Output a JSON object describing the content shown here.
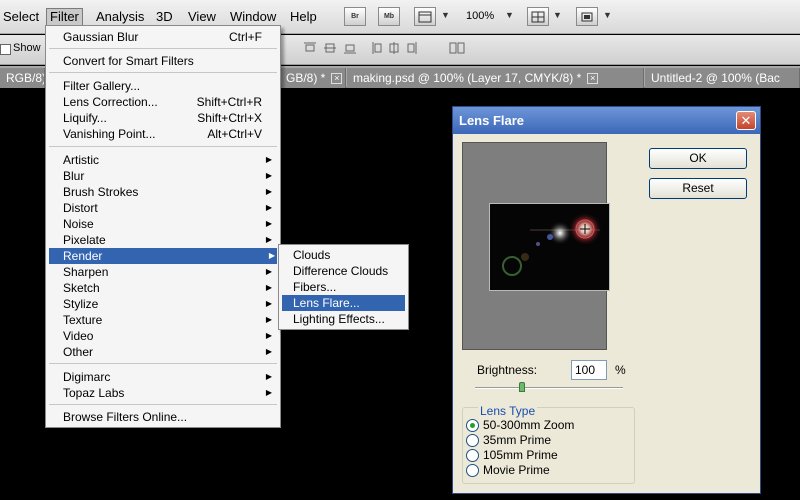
{
  "menubar": {
    "items": [
      "Select",
      "Filter",
      "Analysis",
      "3D",
      "View",
      "Window",
      "Help"
    ],
    "active": "Filter"
  },
  "toolbar": {
    "br_label": "Br",
    "mb_label": "Mb",
    "zoom": "100%",
    "dropdown_glyph": "▼"
  },
  "options": {
    "show_label": "Show"
  },
  "tabs": [
    {
      "label": "RGB/8)"
    },
    {
      "label": "GB/8) *"
    },
    {
      "label": "making.psd @ 100% (Layer 17, CMYK/8) *"
    },
    {
      "label": "Untitled-2 @ 100% (Bac"
    }
  ],
  "filter_menu": {
    "gaussian_blur": {
      "label": "Gaussian Blur",
      "shortcut": "Ctrl+F"
    },
    "convert_smart": "Convert for Smart Filters",
    "filter_gallery": "Filter Gallery...",
    "lens_correction": {
      "label": "Lens Correction...",
      "shortcut": "Shift+Ctrl+R"
    },
    "liquify": {
      "label": "Liquify...",
      "shortcut": "Shift+Ctrl+X"
    },
    "vanishing_point": {
      "label": "Vanishing Point...",
      "shortcut": "Alt+Ctrl+V"
    },
    "submenus": [
      "Artistic",
      "Blur",
      "Brush Strokes",
      "Distort",
      "Noise",
      "Pixelate",
      "Render",
      "Sharpen",
      "Sketch",
      "Stylize",
      "Texture",
      "Video",
      "Other"
    ],
    "highlighted": "Render",
    "plugins": [
      "Digimarc",
      "Topaz Labs"
    ],
    "browse_online": "Browse Filters Online..."
  },
  "render_submenu": {
    "items": [
      "Clouds",
      "Difference Clouds",
      "Fibers...",
      "Lens Flare...",
      "Lighting Effects..."
    ],
    "highlighted": "Lens Flare..."
  },
  "dialog": {
    "title": "Lens Flare",
    "ok": "OK",
    "reset": "Reset",
    "brightness_label": "Brightness:",
    "brightness_value": "100",
    "brightness_unit": "%",
    "lens_type_label": "Lens Type",
    "lens_types": [
      "50-300mm Zoom",
      "35mm Prime",
      "105mm Prime",
      "Movie Prime"
    ],
    "selected_lens": "50-300mm Zoom"
  },
  "icons": {
    "close": "close-icon",
    "submenu_arrow": "chevron-right-icon",
    "dropdown": "chevron-down-icon"
  },
  "colors": {
    "menu_highlight": "#3264b0",
    "dialog_title": "#4a75c4",
    "radio_selected": "#21a121"
  }
}
